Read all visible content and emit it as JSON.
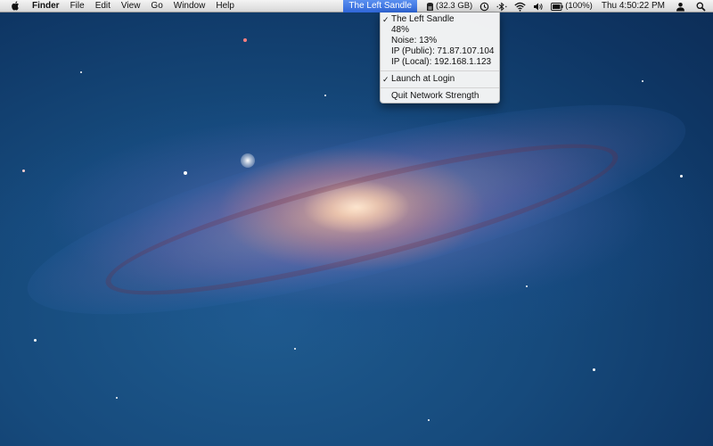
{
  "menubar": {
    "app_name": "Finder",
    "menus": [
      "File",
      "Edit",
      "View",
      "Go",
      "Window",
      "Help"
    ],
    "status": {
      "network_name": "The Left Sandle",
      "disk_free": "(32.3 GB)",
      "battery": "(100%)",
      "clock": "Thu 4:50:22 PM",
      "icons": [
        "time-machine-icon",
        "bluetooth-icon",
        "wifi-icon",
        "volume-icon",
        "battery-icon",
        "user-icon",
        "spotlight-icon"
      ]
    }
  },
  "dropdown": {
    "items": [
      {
        "label": "The Left Sandle",
        "checked": true
      },
      {
        "label": "48%"
      },
      {
        "label": "Noise: 13%"
      },
      {
        "label": "IP (Public): 71.87.107.104"
      },
      {
        "label": "IP (Local): 192.168.1.123"
      }
    ],
    "launch_at_login": {
      "label": "Launch at Login",
      "checked": true
    },
    "quit": {
      "label": "Quit Network Strength"
    },
    "check_glyph": "✓"
  },
  "colors": {
    "menubar_highlight": "#3a71e0",
    "desktop_base": "#164a7c"
  }
}
